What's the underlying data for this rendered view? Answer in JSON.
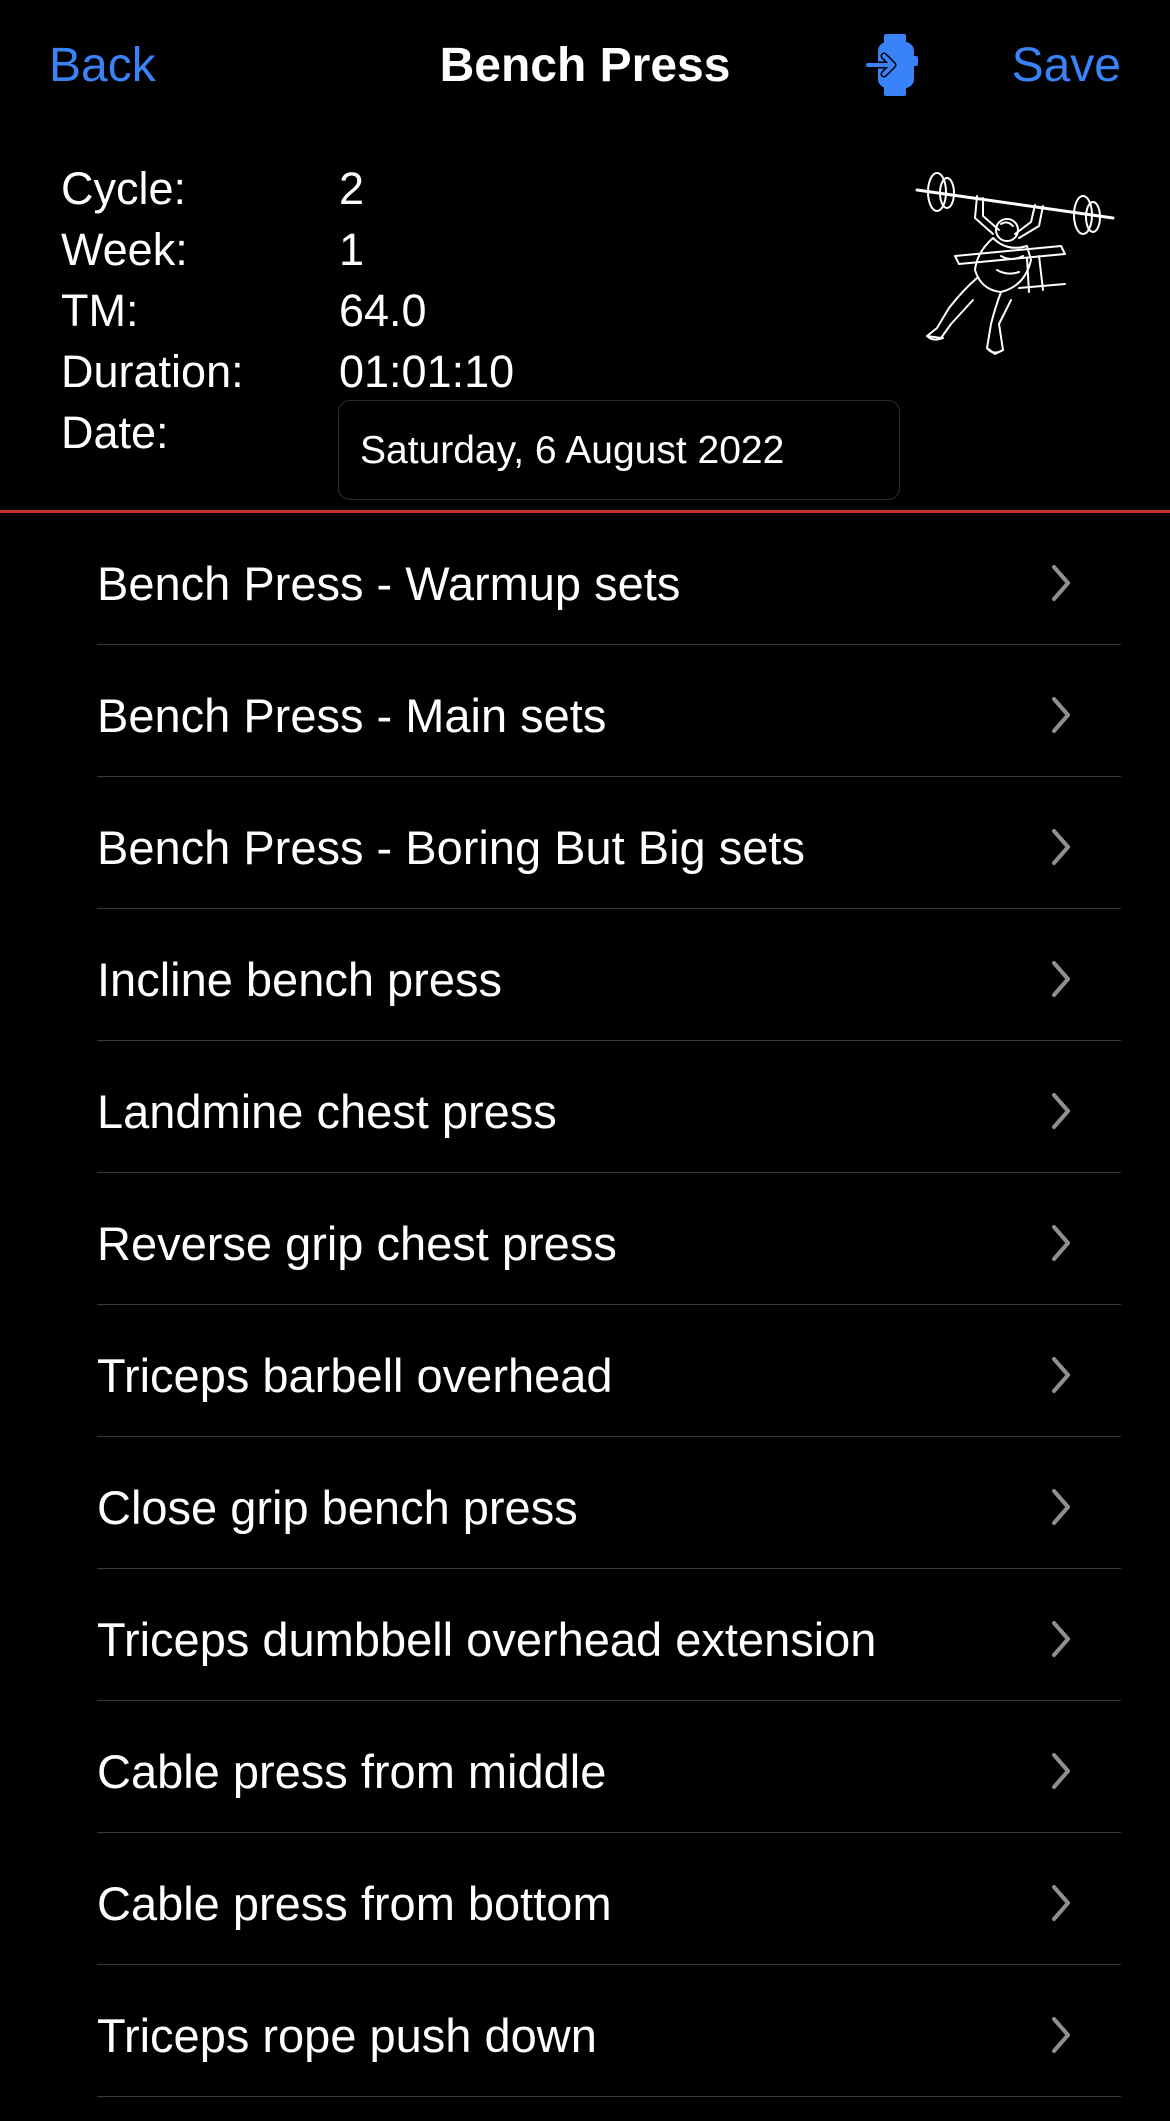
{
  "nav": {
    "back_label": "Back",
    "title": "Bench Press",
    "save_label": "Save",
    "watch_icon": "apple-watch-send-icon"
  },
  "info": {
    "cycle_label": "Cycle:",
    "cycle_value": "2",
    "week_label": "Week:",
    "week_value": "1",
    "tm_label": "TM:",
    "tm_value": "64.0",
    "duration_label": "Duration:",
    "duration_value": "01:01:10",
    "date_label": "Date:",
    "date_value": "Saturday, 6 August 2022"
  },
  "illustration_icon": "bench-press-illustration",
  "colors": {
    "accent": "#3a82f7",
    "divider": "#c9302c",
    "background": "#000000",
    "chevron": "#8e8e93"
  },
  "exercises": [
    {
      "label": "Bench Press - Warmup sets"
    },
    {
      "label": "Bench Press - Main sets"
    },
    {
      "label": "Bench Press - Boring But Big sets"
    },
    {
      "label": "Incline bench press"
    },
    {
      "label": "Landmine chest press"
    },
    {
      "label": "Reverse grip chest press"
    },
    {
      "label": "Triceps barbell overhead"
    },
    {
      "label": "Close grip bench press"
    },
    {
      "label": "Triceps dumbbell overhead extension"
    },
    {
      "label": "Cable press from middle"
    },
    {
      "label": "Cable press from bottom"
    },
    {
      "label": "Triceps rope push down"
    }
  ]
}
